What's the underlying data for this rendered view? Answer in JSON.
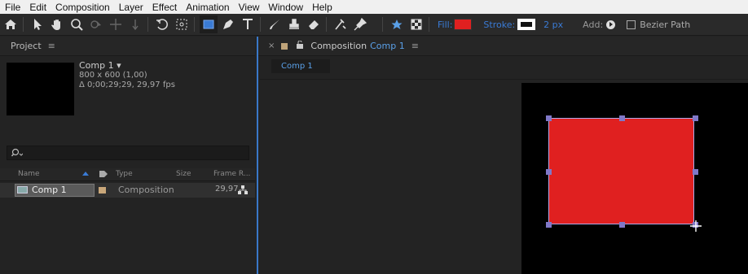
{
  "menu": [
    "File",
    "Edit",
    "Composition",
    "Layer",
    "Effect",
    "Animation",
    "View",
    "Window",
    "Help"
  ],
  "toolbar": {
    "fill_label": "Fill:",
    "fill_color": "#e02020",
    "stroke_label": "Stroke:",
    "stroke_width": "2 px",
    "add_label": "Add:",
    "bezier_label": "Bezier Path"
  },
  "project": {
    "title": "Project",
    "comp_name": "Comp 1 ▾",
    "comp_dims": "800 x 600 (1,00)",
    "comp_duration": "Δ 0;00;29;29, 29,97 fps",
    "columns": [
      "Name",
      "Type",
      "Size",
      "Frame R..."
    ],
    "items": [
      {
        "name": "Comp 1",
        "type": "Composition",
        "fps": "29,97"
      }
    ]
  },
  "composition": {
    "tab_prefix": "Composition",
    "tab_name": "Comp 1",
    "subtab": "Comp 1"
  }
}
